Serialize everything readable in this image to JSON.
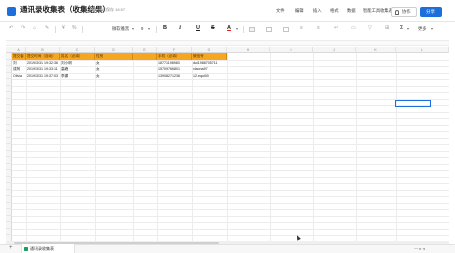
{
  "header": {
    "title": "通讯录收集表（收集结果）",
    "save_status": "最近保存 16:57",
    "menus": [
      "文件",
      "编辑",
      "插入",
      "格式",
      "数据",
      "智能工具",
      "收集表"
    ],
    "collab_label": "协作",
    "share_label": "分享"
  },
  "toolbar": {
    "undo_label": "↶",
    "redo_label": "↷",
    "format_painter_label": "⌂",
    "clear_label": "✎",
    "currency_label": "¥",
    "percent_label": "%",
    "font_name": "微软雅黑",
    "font_size": "9",
    "bold_label": "B",
    "italic_label": "I",
    "underline_label": "U",
    "strike_label": "S",
    "text_color_label": "A",
    "more_label": "更多"
  },
  "columns": [
    "A",
    "B",
    "C",
    "D",
    "E",
    "F",
    "G",
    "H",
    "I",
    "J",
    "K",
    "L"
  ],
  "table": {
    "headers": [
      "提交者（自动）",
      "提交时间（自动）",
      "姓名（必填）",
      "性别",
      "手机（必填）",
      "微信号"
    ],
    "rows": [
      [
        "刘",
        "2019/3/31 19:32:36",
        "刘小明",
        "女",
        "18771198983",
        "dui1988705711"
      ],
      [
        "成阿",
        "2019/3/31 19:33:11",
        "高峰",
        "女",
        "15709766801",
        "xiaona97"
      ],
      [
        "Olivia",
        "2019/3/31 19:37:03",
        "李娜",
        "女",
        "13908271236",
        "12.equi00"
      ]
    ]
  },
  "sheets": [
    {
      "name": "通讯录收集表"
    }
  ],
  "sheetbar": {
    "add_label": "+",
    "zoom_label": "— ▸ ◂"
  },
  "colors": {
    "accent": "#1d6fdc",
    "header_fill": "#f5a623",
    "sheet_icon": "#1aa260"
  }
}
